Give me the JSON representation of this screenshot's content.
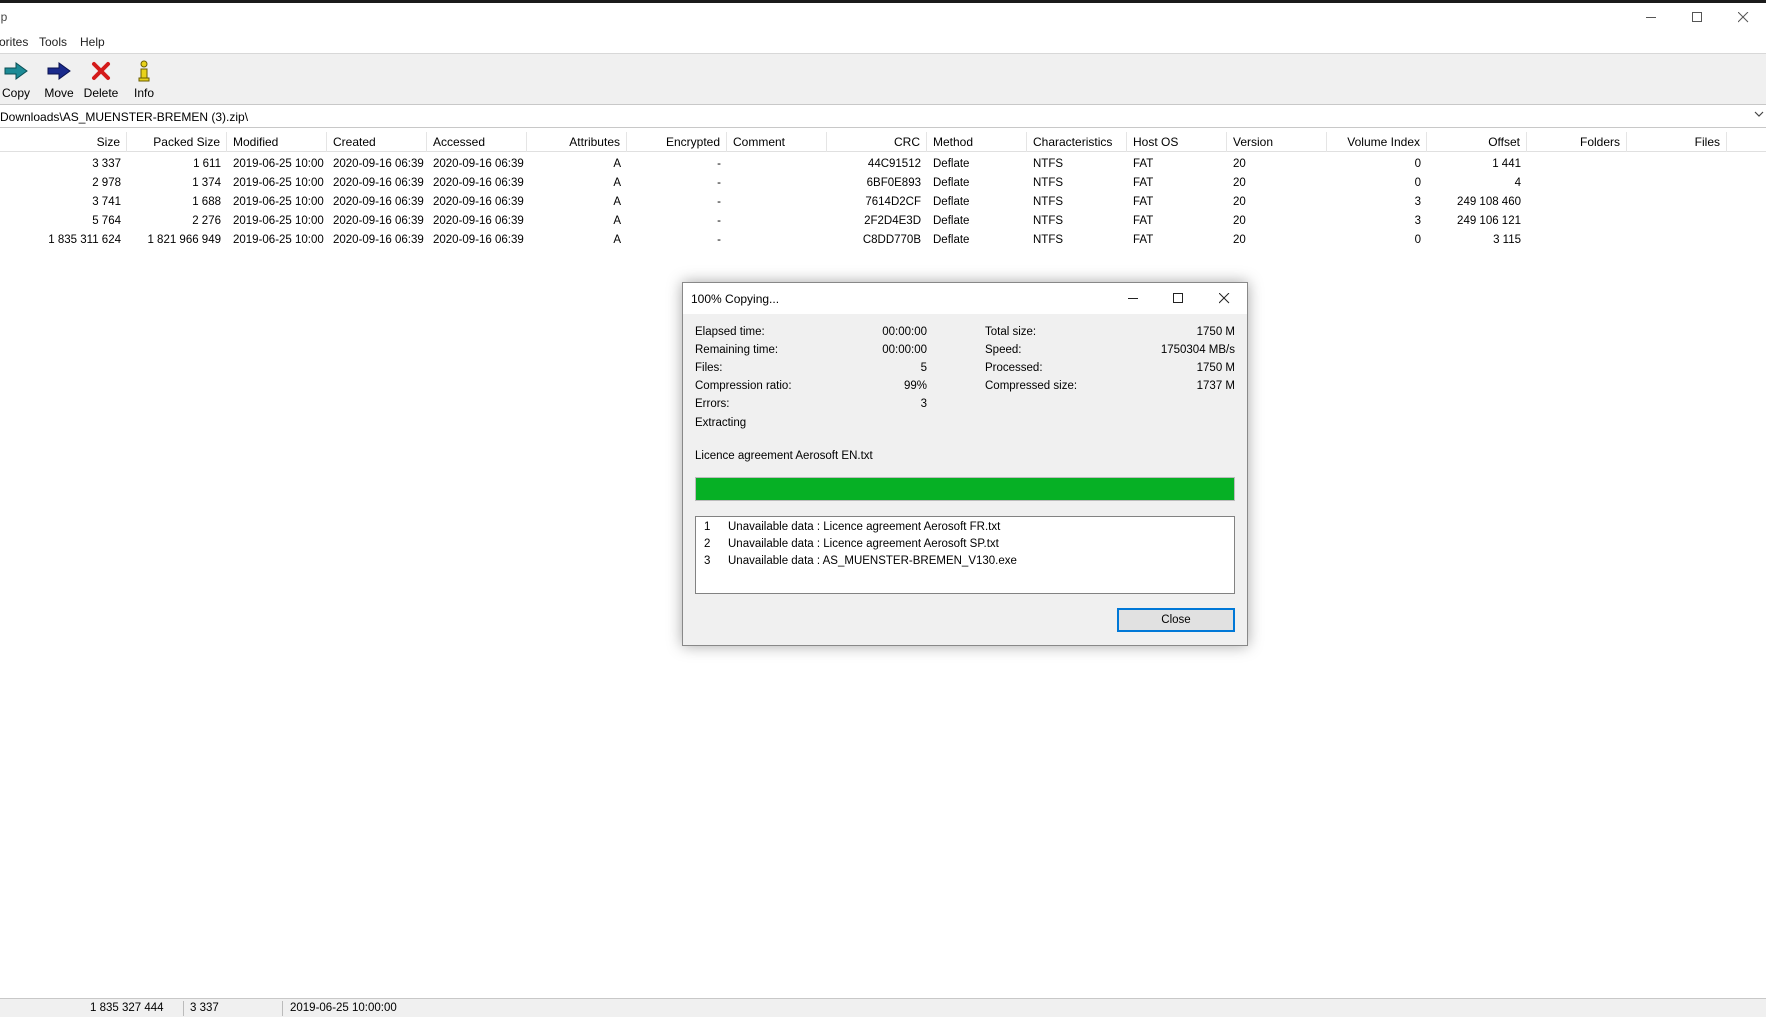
{
  "app": {
    "title": "ip"
  },
  "window_buttons": {
    "minimize": "─",
    "maximize": "☐",
    "close": "✕"
  },
  "menu": [
    "orites",
    "Tools",
    "Help"
  ],
  "toolbar": [
    {
      "label": "Copy",
      "icon": "copy-arrow-icon"
    },
    {
      "label": "Move",
      "icon": "move-arrow-icon"
    },
    {
      "label": "Delete",
      "icon": "delete-x-icon"
    },
    {
      "label": "Info",
      "icon": "info-icon"
    }
  ],
  "address": {
    "path": "Downloads\\AS_MUENSTER-BREMEN (3).zip\\"
  },
  "columns": [
    "Size",
    "Packed Size",
    "Modified",
    "Created",
    "Accessed",
    "Attributes",
    "Encrypted",
    "Comment",
    "CRC",
    "Method",
    "Characteristics",
    "Host OS",
    "Version",
    "Volume Index",
    "Offset",
    "Folders",
    "Files"
  ],
  "rows": [
    [
      "3 337",
      "1 611",
      "2019-06-25 10:00",
      "2020-09-16 06:39",
      "2020-09-16 06:39",
      "A",
      "-",
      "",
      "44C91512",
      "Deflate",
      "NTFS",
      "FAT",
      "20",
      "0",
      "1 441",
      "",
      ""
    ],
    [
      "2 978",
      "1 374",
      "2019-06-25 10:00",
      "2020-09-16 06:39",
      "2020-09-16 06:39",
      "A",
      "-",
      "",
      "6BF0E893",
      "Deflate",
      "NTFS",
      "FAT",
      "20",
      "0",
      "4",
      "",
      ""
    ],
    [
      "3 741",
      "1 688",
      "2019-06-25 10:00",
      "2020-09-16 06:39",
      "2020-09-16 06:39",
      "A",
      "-",
      "",
      "7614D2CF",
      "Deflate",
      "NTFS",
      "FAT",
      "20",
      "3",
      "249 108 460",
      "",
      ""
    ],
    [
      "5 764",
      "2 276",
      "2019-06-25 10:00",
      "2020-09-16 06:39",
      "2020-09-16 06:39",
      "A",
      "-",
      "",
      "2F2D4E3D",
      "Deflate",
      "NTFS",
      "FAT",
      "20",
      "3",
      "249 106 121",
      "",
      ""
    ],
    [
      "1 835 311 624",
      "1 821 966 949",
      "2019-06-25 10:00",
      "2020-09-16 06:39",
      "2020-09-16 06:39",
      "A",
      "-",
      "",
      "C8DD770B",
      "Deflate",
      "NTFS",
      "FAT",
      "20",
      "0",
      "3 115",
      "",
      ""
    ]
  ],
  "statusbar": {
    "total_size": "1 835 327 444",
    "selected_size": "3 337",
    "modified": "2019-06-25 10:00:00"
  },
  "dialog": {
    "title": "100% Copying...",
    "left_stats": [
      {
        "label": "Elapsed time:",
        "value": "00:00:00"
      },
      {
        "label": "Remaining time:",
        "value": "00:00:00"
      },
      {
        "label": "Files:",
        "value": "5"
      },
      {
        "label": "Compression ratio:",
        "value": "99%"
      },
      {
        "label": "Errors:",
        "value": "3"
      }
    ],
    "right_stats": [
      {
        "label": "Total size:",
        "value": "1750 M"
      },
      {
        "label": "Speed:",
        "value": "1750304 MB/s"
      },
      {
        "label": "Processed:",
        "value": "1750 M"
      },
      {
        "label": "Compressed size:",
        "value": "1737 M"
      }
    ],
    "operation": "Extracting",
    "current_file": "Licence agreement Aerosoft EN.txt",
    "progress": 1.0,
    "progress_color": "#06b025",
    "errors": [
      {
        "num": "1",
        "text": "Unavailable data : Licence agreement Aerosoft FR.txt"
      },
      {
        "num": "2",
        "text": "Unavailable data : Licence agreement Aerosoft SP.txt"
      },
      {
        "num": "3",
        "text": "Unavailable data : AS_MUENSTER-BREMEN_V130.exe"
      }
    ],
    "close_label": "Close"
  }
}
